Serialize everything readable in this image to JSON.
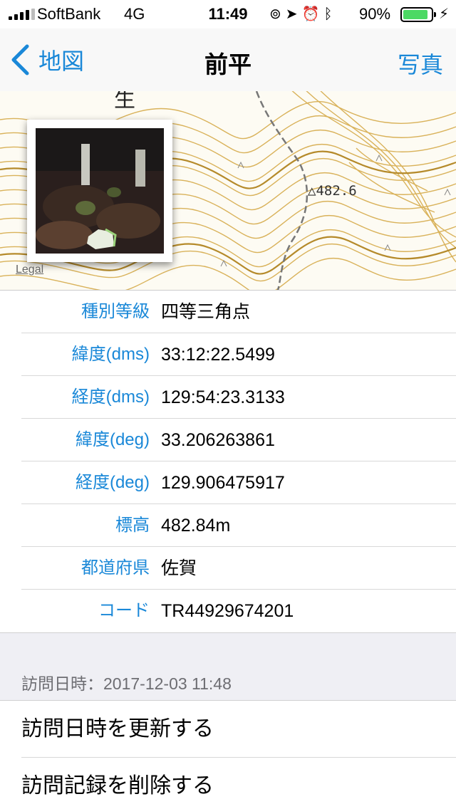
{
  "status_bar": {
    "carrier": "SoftBank",
    "network": "4G",
    "time": "11:49",
    "icons": [
      "orientation-lock-icon",
      "location-arrow-icon",
      "alarm-icon",
      "bluetooth-icon"
    ],
    "battery_percent_text": "90%",
    "battery_level": 0.9,
    "battery_color": "#4cd964"
  },
  "nav": {
    "back_label": "地図",
    "title": "前平",
    "right_label": "写真",
    "accent_color": "#1a88d8"
  },
  "map": {
    "elevation_label": "△482.6",
    "kanji_label": "生",
    "legal_label": "Legal"
  },
  "info_rows": [
    {
      "label": "種別等級",
      "value": "四等三角点"
    },
    {
      "label": "緯度(dms)",
      "value": "33:12:22.5499"
    },
    {
      "label": "経度(dms)",
      "value": "129:54:23.3133"
    },
    {
      "label": "緯度(deg)",
      "value": "33.206263861"
    },
    {
      "label": "経度(deg)",
      "value": "129.906475917"
    },
    {
      "label": "標高",
      "value": "482.84m"
    },
    {
      "label": "都道府県",
      "value": "佐賀"
    },
    {
      "label": "コード",
      "value": "TR44929674201"
    }
  ],
  "visit": {
    "header": "訪問日時：2017-12-03 11:48",
    "update_label": "訪問日時を更新する",
    "delete_label": "訪問記録を削除する"
  }
}
